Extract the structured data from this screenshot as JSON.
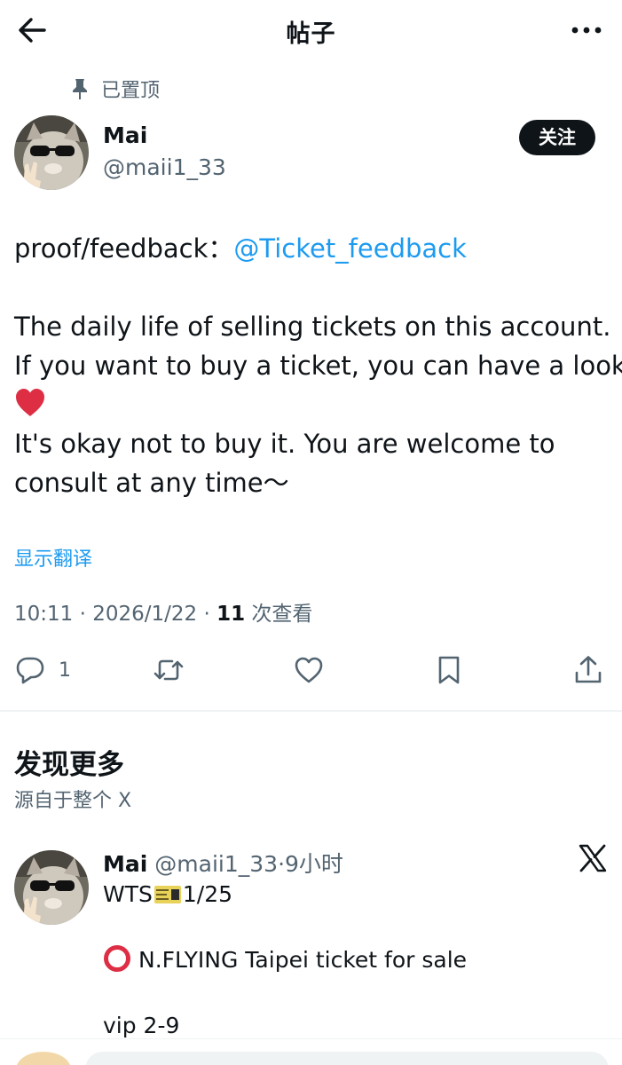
{
  "header": {
    "title": "帖子",
    "back_icon": "arrow-left-icon",
    "more_icon": "more-horizontal-icon"
  },
  "post": {
    "pinned_label": "已置顶",
    "author_name": "Mai",
    "author_handle": "@maii1_33",
    "follow_label": "关注",
    "text": {
      "proof_prefix": "proof/feedback：",
      "mention": "@Ticket_feedback",
      "line1": "The daily life of selling tickets on this account.",
      "line2": "If you want to buy a ticket, you can have a look",
      "line3": "It's okay not to buy it. You are welcome to",
      "line4": "consult at any time～"
    },
    "translate_label": "显示翻译",
    "meta": {
      "time": "10:11 · 2026/1/22 · ",
      "views": "11",
      "views_label": " 次查看"
    },
    "actions": {
      "reply_count": "1"
    }
  },
  "discover": {
    "title": "发现更多",
    "subtitle": "源自于整个 X",
    "item": {
      "author_name": "Mai",
      "author_handle": "@maii1_33",
      "time": "·9小时",
      "line1_prefix": "WTS",
      "line1_suffix": "1/25",
      "line2": "N.FLYING Taipei ticket for sale",
      "line3": "vip 2-9"
    }
  },
  "colors": {
    "accent": "#1d9bf0",
    "text": "#0f1419",
    "secondary": "#536471",
    "divider": "#eff3f4"
  }
}
